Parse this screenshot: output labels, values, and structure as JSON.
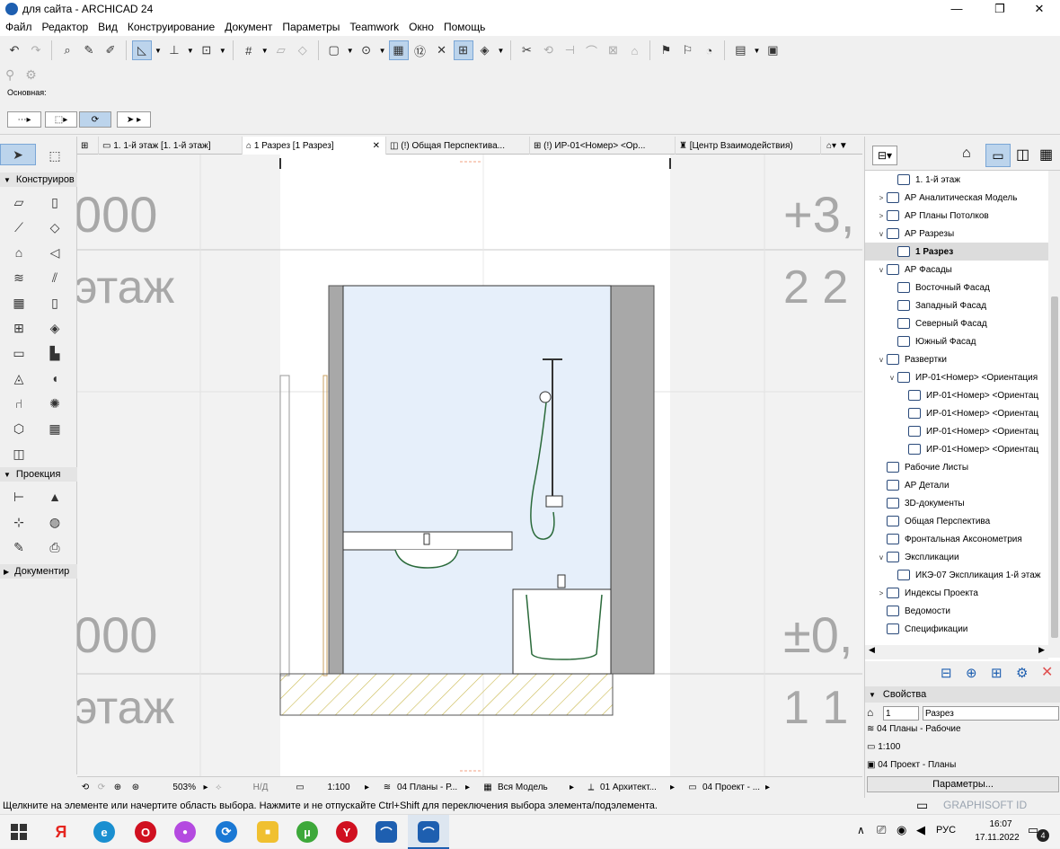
{
  "window": {
    "title": "для сайта - ARCHICAD 24",
    "minimize": "—",
    "maximize": "❐",
    "close": "✕"
  },
  "menu": [
    "Файл",
    "Редактор",
    "Вид",
    "Конструирование",
    "Документ",
    "Параметры",
    "Teamwork",
    "Окно",
    "Помощь"
  ],
  "infobox": {
    "label": "Основная:"
  },
  "toolbox": {
    "sections": [
      "Конструиров",
      "Проекция",
      "Документир"
    ]
  },
  "tabs": [
    {
      "label": "1. 1-й этаж [1. 1-й этаж]"
    },
    {
      "label": "1 Разрез [1 Разрез]",
      "close": "✕"
    },
    {
      "label": "(!) Общая Перспектива..."
    },
    {
      "label": "(!) ИР-01<Номер> <Ор..."
    },
    {
      "label": "[Центр Взаимодействия)"
    }
  ],
  "canvas": {
    "left_labels": [
      "000",
      "этаж",
      "000",
      "этаж"
    ],
    "right_labels": [
      "+3,",
      "2 2",
      "±0,",
      "1 1"
    ]
  },
  "statusrow": {
    "zoom": "503%",
    "angle": "Н/Д",
    "scale": "1:100",
    "layers": "04 Планы - Р...",
    "model": "Вся Модель",
    "pen": "01 Архитект...",
    "override": "04 Проект - ..."
  },
  "statusline": "Щелкните на элементе или начертите область выбора. Нажмите и не отпускайте Ctrl+Shift для переключения выбора элемента/подэлемента.",
  "navigator": {
    "items": [
      {
        "label": "1. 1-й этаж",
        "indent": 2,
        "arrow": ""
      },
      {
        "label": "АР Аналитическая Модель",
        "indent": 1,
        "arrow": ">"
      },
      {
        "label": "АР Планы Потолков",
        "indent": 1,
        "arrow": ">"
      },
      {
        "label": "АР Разрезы",
        "indent": 1,
        "arrow": "v"
      },
      {
        "label": "1 Разрез",
        "indent": 2,
        "arrow": "",
        "selected": true
      },
      {
        "label": "АР Фасады",
        "indent": 1,
        "arrow": "v"
      },
      {
        "label": "Восточный Фасад",
        "indent": 2,
        "arrow": ""
      },
      {
        "label": "Западный Фасад",
        "indent": 2,
        "arrow": ""
      },
      {
        "label": "Северный Фасад",
        "indent": 2,
        "arrow": ""
      },
      {
        "label": "Южный Фасад",
        "indent": 2,
        "arrow": ""
      },
      {
        "label": "Развертки",
        "indent": 1,
        "arrow": "v"
      },
      {
        "label": "ИР-01<Номер> <Ориентация",
        "indent": 2,
        "arrow": "v"
      },
      {
        "label": "ИР-01<Номер> <Ориентац",
        "indent": 3,
        "arrow": ""
      },
      {
        "label": "ИР-01<Номер> <Ориентац",
        "indent": 3,
        "arrow": ""
      },
      {
        "label": "ИР-01<Номер> <Ориентац",
        "indent": 3,
        "arrow": ""
      },
      {
        "label": "ИР-01<Номер> <Ориентац",
        "indent": 3,
        "arrow": ""
      },
      {
        "label": "Рабочие Листы",
        "indent": 1,
        "arrow": ""
      },
      {
        "label": "АР Детали",
        "indent": 1,
        "arrow": ""
      },
      {
        "label": "3D-документы",
        "indent": 1,
        "arrow": ""
      },
      {
        "label": "Общая Перспектива",
        "indent": 1,
        "arrow": ""
      },
      {
        "label": "Фронтальная Аксонометрия",
        "indent": 1,
        "arrow": ""
      },
      {
        "label": "Экспликации",
        "indent": 1,
        "arrow": "v"
      },
      {
        "label": "ИКЭ-07 Экспликация 1-й этаж",
        "indent": 2,
        "arrow": ""
      },
      {
        "label": "Индексы Проекта",
        "indent": 1,
        "arrow": ">"
      },
      {
        "label": "Ведомости",
        "indent": 1,
        "arrow": ""
      },
      {
        "label": "Спецификации",
        "indent": 1,
        "arrow": ""
      }
    ]
  },
  "properties": {
    "header": "Свойства",
    "id_value": "1",
    "name_value": "Разрез",
    "layers": "04 Планы - Рабочие",
    "scale": "1:100",
    "pen_set": "04 Проект - Планы",
    "button": "Параметры...",
    "graphisoft": "GRAPHISOFT ID"
  },
  "taskbar": {
    "language": "РУС",
    "time": "16:07",
    "date": "17.11.2022",
    "notifications": "4",
    "apps": [
      {
        "name": "Yandex",
        "letter": "Я",
        "color": "#e52620"
      },
      {
        "name": "Edge",
        "letter": "e",
        "color": "#1a8fd0"
      },
      {
        "name": "Opera",
        "letter": "O",
        "color": "#d01020"
      },
      {
        "name": "Paint",
        "letter": "●",
        "color": "#b44ae0"
      },
      {
        "name": "Store",
        "letter": "▣",
        "color": "#6a6a6a"
      },
      {
        "name": "Explorer",
        "letter": "▇",
        "color": "#e8b030"
      },
      {
        "name": "Power",
        "letter": "⟳",
        "color": "#1a78d4"
      },
      {
        "name": "Files",
        "letter": "■",
        "color": "#f0c030"
      },
      {
        "name": "Torrent",
        "letter": "µ",
        "color": "#3da83a"
      },
      {
        "name": "YandexBrowser",
        "letter": "Y",
        "color": "#d01020"
      },
      {
        "name": "Archicad",
        "letter": "⌒",
        "color": "#1e5fb0"
      },
      {
        "name": "Archicad2",
        "letter": "⌒",
        "color": "#1e5fb0"
      }
    ]
  },
  "colors": {
    "room_fill": "#e6effa",
    "wall_gray": "#a8a8a8",
    "hatch": "#c9b84c",
    "accent": "#1e5fb0"
  }
}
